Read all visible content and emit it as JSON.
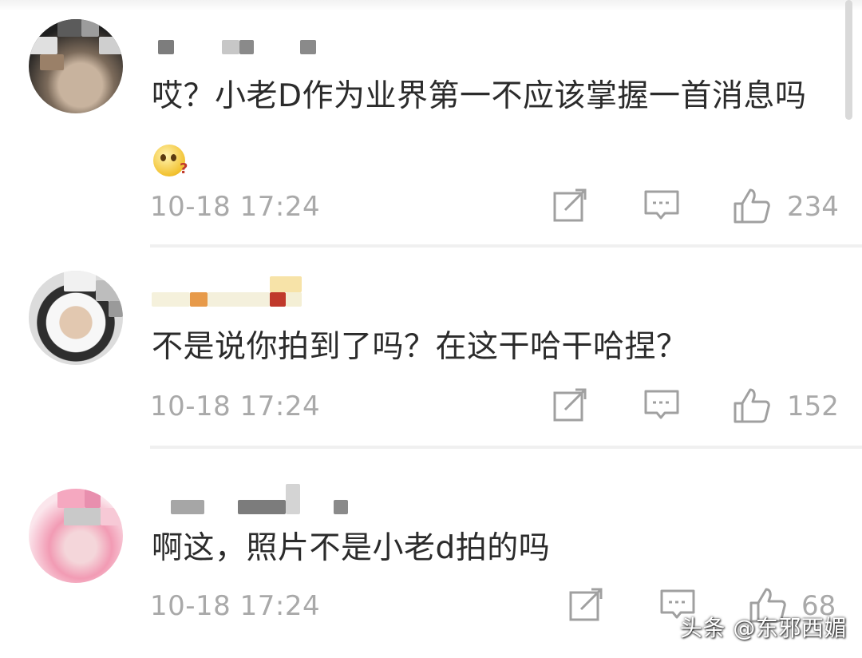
{
  "comments": [
    {
      "text": "哎？小老D作为业界第一不应该掌握一首消息吗",
      "emoji": "thinking-face-emoji",
      "timestamp": "10-18 17:24",
      "like_count": "234"
    },
    {
      "text": "不是说你拍到了吗？在这干哈干哈捏？",
      "timestamp": "10-18 17:24",
      "like_count": "152"
    },
    {
      "text": "啊这，照片不是小老d拍的吗",
      "timestamp": "10-18 17:24",
      "like_count": "68"
    }
  ],
  "icons": {
    "share": "share-icon",
    "reply": "comment-icon",
    "like": "thumbs-up-icon"
  },
  "watermark": "头条 @东邪西媚",
  "colors": {
    "text": "#2b2b2b",
    "meta": "#a9a9a9",
    "icon": "#a0a0a0",
    "divider": "#f0f0f0"
  }
}
